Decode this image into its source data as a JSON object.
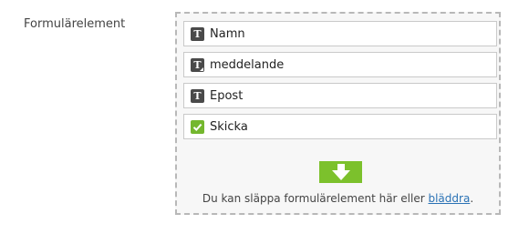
{
  "field": {
    "label": "Formulärelement"
  },
  "elements": [
    {
      "label": "Namn",
      "icon": "text-field-icon"
    },
    {
      "label": "meddelande",
      "icon": "textarea-icon"
    },
    {
      "label": "Epost",
      "icon": "text-field-icon"
    },
    {
      "label": "Skicka",
      "icon": "checkmark-icon"
    }
  ],
  "icons": {
    "text_glyph": "T"
  },
  "dropzone": {
    "hint_prefix": "Du kan släppa formulärelement här eller ",
    "browse_link": "bläddra",
    "hint_suffix": "."
  },
  "colors": {
    "accent_green": "#7cc12c",
    "link_blue": "#2a72b5"
  }
}
